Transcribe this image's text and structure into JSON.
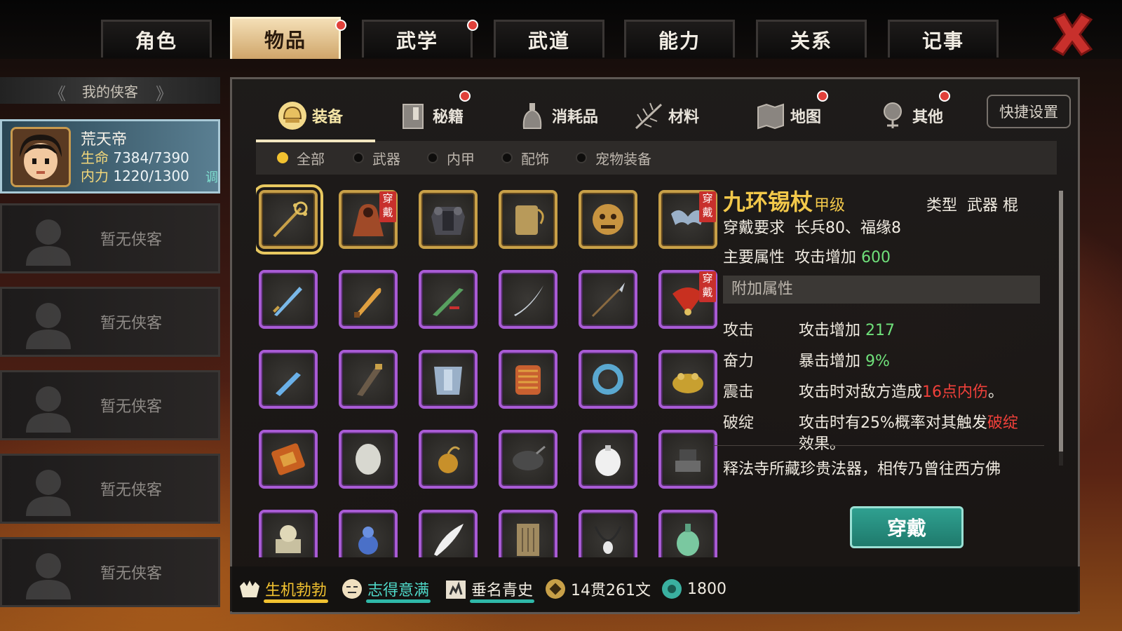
{
  "top_tabs": [
    {
      "label": "角色",
      "active": false,
      "alert": false
    },
    {
      "label": "物品",
      "active": true,
      "alert": true
    },
    {
      "label": "武学",
      "active": false,
      "alert": true
    },
    {
      "label": "武道",
      "active": false,
      "alert": false
    },
    {
      "label": "能力",
      "active": false,
      "alert": false
    },
    {
      "label": "关系",
      "active": false,
      "alert": false
    },
    {
      "label": "记事",
      "active": false,
      "alert": false
    }
  ],
  "sidebar": {
    "header": "我的侠客",
    "hero": {
      "name": "荒天帝",
      "hp_label": "生命",
      "hp": "7384/7390",
      "mp_label": "内力",
      "mp": "1220/1300",
      "tune": "调"
    },
    "empty_slots": [
      "暂无侠客",
      "暂无侠客",
      "暂无侠客",
      "暂无侠客",
      "暂无侠客"
    ]
  },
  "sub_tabs": [
    {
      "label": "装备",
      "icon": "helmet-icon",
      "active": true,
      "alert": false
    },
    {
      "label": "秘籍",
      "icon": "book-icon",
      "active": false,
      "alert": true
    },
    {
      "label": "消耗品",
      "icon": "potion-icon",
      "active": false,
      "alert": false
    },
    {
      "label": "材料",
      "icon": "herb-icon",
      "active": false,
      "alert": false
    },
    {
      "label": "地图",
      "icon": "map-icon",
      "active": false,
      "alert": true
    },
    {
      "label": "其他",
      "icon": "misc-icon",
      "active": false,
      "alert": true
    }
  ],
  "quick_settings": "快捷设置",
  "filters": [
    {
      "label": "全部",
      "active": true
    },
    {
      "label": "武器",
      "active": false
    },
    {
      "label": "内甲",
      "active": false
    },
    {
      "label": "配饰",
      "active": false
    },
    {
      "label": "宠物装备",
      "active": false
    }
  ],
  "worn_label": "穿戴",
  "items": [
    {
      "icon": "staff-icon",
      "rarity": "gold",
      "worn": false,
      "selected": true
    },
    {
      "icon": "cloak-icon",
      "rarity": "gold",
      "worn": true
    },
    {
      "icon": "armor-icon",
      "rarity": "gold",
      "worn": false
    },
    {
      "icon": "scroll-pouch-icon",
      "rarity": "gold",
      "worn": false
    },
    {
      "icon": "mask-icon",
      "rarity": "gold",
      "worn": false
    },
    {
      "icon": "ribbon-icon",
      "rarity": "gold",
      "worn": true
    },
    {
      "icon": "sword-icon",
      "rarity": "purple",
      "worn": false
    },
    {
      "icon": "dagger-icon",
      "rarity": "purple",
      "worn": false
    },
    {
      "icon": "green-blade-icon",
      "rarity": "purple",
      "worn": false
    },
    {
      "icon": "curved-saber-icon",
      "rarity": "purple",
      "worn": false
    },
    {
      "icon": "spear-icon",
      "rarity": "purple",
      "worn": false
    },
    {
      "icon": "feather-fan-icon",
      "rarity": "purple",
      "worn": true
    },
    {
      "icon": "short-sword-icon",
      "rarity": "purple",
      "worn": false
    },
    {
      "icon": "scabbard-icon",
      "rarity": "purple",
      "worn": false
    },
    {
      "icon": "chest-plate-icon",
      "rarity": "purple",
      "worn": false
    },
    {
      "icon": "scale-armor-icon",
      "rarity": "purple",
      "worn": false
    },
    {
      "icon": "jade-ring-icon",
      "rarity": "purple",
      "worn": false
    },
    {
      "icon": "gold-toad-icon",
      "rarity": "purple",
      "worn": false
    },
    {
      "icon": "talisman-icon",
      "rarity": "purple",
      "worn": false
    },
    {
      "icon": "stone-icon",
      "rarity": "purple",
      "worn": false
    },
    {
      "icon": "bell-icon",
      "rarity": "purple",
      "worn": false
    },
    {
      "icon": "wok-icon",
      "rarity": "purple",
      "worn": false
    },
    {
      "icon": "egg-pouch-icon",
      "rarity": "purple",
      "worn": false
    },
    {
      "icon": "anvil-icon",
      "rarity": "purple",
      "worn": false
    },
    {
      "icon": "seal-icon",
      "rarity": "purple",
      "worn": false
    },
    {
      "icon": "gourd-icon",
      "rarity": "purple",
      "worn": false
    },
    {
      "icon": "white-feather-icon",
      "rarity": "purple",
      "worn": false
    },
    {
      "icon": "scripture-icon",
      "rarity": "purple",
      "worn": false
    },
    {
      "icon": "necklace-icon",
      "rarity": "purple",
      "worn": false
    },
    {
      "icon": "jade-pendant-icon",
      "rarity": "purple",
      "worn": false
    }
  ],
  "detail": {
    "name": "九环锡杖",
    "grade": "甲级",
    "type_label": "类型",
    "type_value": "武器 棍",
    "req_label": "穿戴要求",
    "req_value": "长兵80、福缘8",
    "main_label": "主要属性",
    "main_text": "攻击增加",
    "main_value": "600",
    "extra_header": "附加属性",
    "attrs": [
      {
        "key": "攻击",
        "pre": "攻击增加 ",
        "hl": "217",
        "hl_color": "green",
        "post": ""
      },
      {
        "key": "奋力",
        "pre": "暴击增加 ",
        "hl": "9%",
        "hl_color": "green",
        "post": ""
      },
      {
        "key": "震击",
        "pre": "攻击时对敌方造成",
        "hl": "16点内伤",
        "hl_color": "red",
        "post": "。"
      },
      {
        "key": "破绽",
        "pre": "攻击时有25%概率对其触发",
        "hl": "破绽",
        "hl_color": "red",
        "post": "",
        "line2": "效果。"
      }
    ],
    "description": "释法寺所藏珍贵法器，相传乃曾往西方佛"
  },
  "wear_button": "穿戴",
  "status": [
    {
      "icon": "vitality-icon",
      "label": "生机勃勃",
      "color": "#f2c230",
      "bar": "#f2c230"
    },
    {
      "icon": "mood-icon",
      "label": "志得意满",
      "color": "#4fd8c8",
      "bar": "#2fb8a8"
    },
    {
      "icon": "fame-icon",
      "label": "垂名青史",
      "color": "#f0ebe1",
      "bar": "#2fb8a8"
    },
    {
      "icon": "coin-icon",
      "label": "14贯261文",
      "color": "#f0ebe1"
    },
    {
      "icon": "jade-coin-icon",
      "label": "1800",
      "color": "#f0ebe1"
    }
  ]
}
